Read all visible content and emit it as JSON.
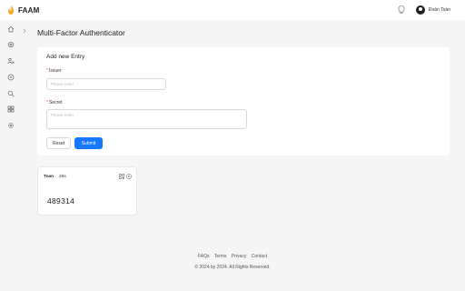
{
  "app": {
    "brand": "FAAM",
    "accent": "#1677ff",
    "logo_color": "#f5a623"
  },
  "user": {
    "name": "Đoàn Toàn"
  },
  "sidebar": {
    "items": [
      {
        "icon": "home-icon"
      },
      {
        "icon": "settings-cog-icon"
      },
      {
        "icon": "users-icon"
      },
      {
        "icon": "circle-icon"
      },
      {
        "icon": "search-icon"
      },
      {
        "icon": "grid-icon"
      },
      {
        "icon": "gear-icon"
      }
    ]
  },
  "page": {
    "title": "Multi-Factor Authenticator"
  },
  "form": {
    "title": "Add new Entry",
    "issuer_label": "Issuer",
    "issuer_placeholder": "Please enter",
    "secret_label": "Secret",
    "secret_placeholder": "Please enter",
    "reset_label": "Reset",
    "submit_label": "Submit"
  },
  "entries": [
    {
      "issuer": "Toan",
      "timer": "26s",
      "code": "489314"
    }
  ],
  "footer": {
    "links": [
      "FAQs",
      "Terms",
      "Privacy",
      "Contact"
    ],
    "copyright": "© 2024 by 2024. All Rights Reserved."
  }
}
